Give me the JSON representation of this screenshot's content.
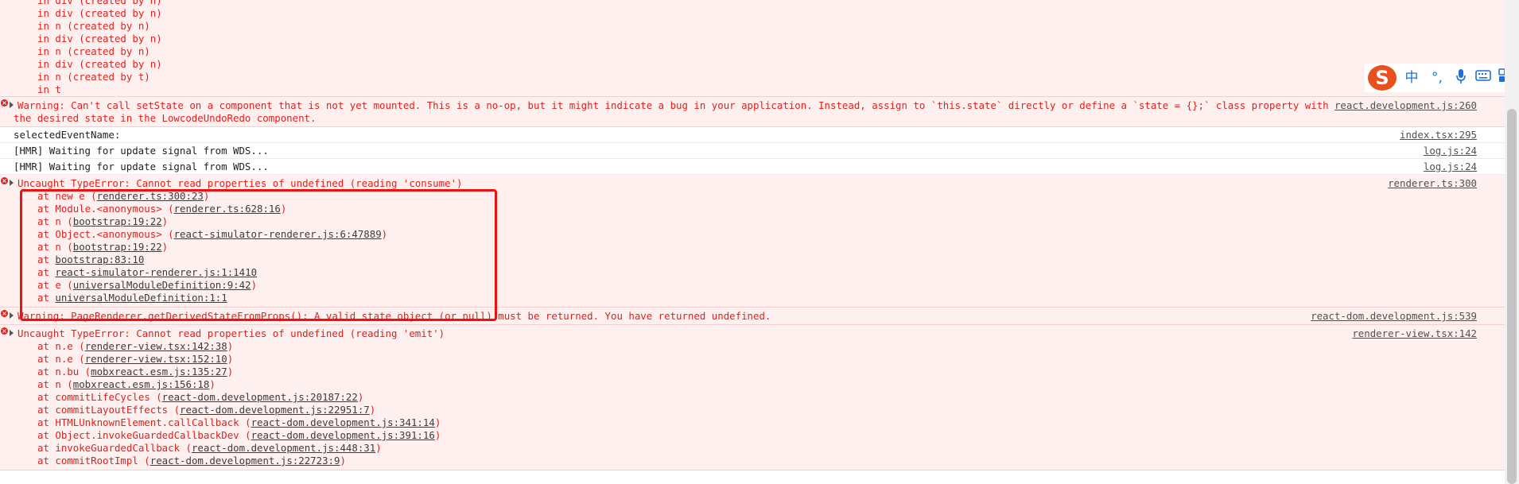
{
  "partial_top": [
    "in div (created by n)",
    "in div (created by n)",
    "in n (created by n)",
    "in div (created by n)",
    "in n (created by n)",
    "in div (created by n)",
    "in n (created by t)",
    "in t"
  ],
  "warning1": {
    "line1": "Warning: Can't call setState on a component that is not yet mounted. This is a no-op, but it might indicate a bug in your application. Instead, assign to `this.state` directly or define a `state = {};` class property with",
    "line2": "the desired state in the LowcodeUndoRedo component.",
    "source": "react.development.js:260"
  },
  "log1": {
    "text": "selectedEventName:",
    "source": "index.tsx:295"
  },
  "log2": {
    "text": "[HMR] Waiting for update signal from WDS...",
    "source": "log.js:24"
  },
  "log3": {
    "text": "[HMR] Waiting for update signal from WDS...",
    "source": "log.js:24"
  },
  "error1": {
    "message": "Uncaught TypeError: Cannot read properties of undefined (reading 'consume')",
    "source": "renderer.ts:300",
    "stack": [
      {
        "prefix": "at new e (",
        "link": "renderer.ts:300:23",
        "suffix": ")"
      },
      {
        "prefix": "at Module.<anonymous> (",
        "link": "renderer.ts:628:16",
        "suffix": ")"
      },
      {
        "prefix": "at n (",
        "link": "bootstrap:19:22",
        "suffix": ")"
      },
      {
        "prefix": "at Object.<anonymous> (",
        "link": "react-simulator-renderer.js:6:47889",
        "suffix": ")"
      },
      {
        "prefix": "at n (",
        "link": "bootstrap:19:22",
        "suffix": ")"
      },
      {
        "prefix": "at ",
        "link": "bootstrap:83:10",
        "suffix": ""
      },
      {
        "prefix": "at ",
        "link": "react-simulator-renderer.js:1:1410",
        "suffix": ""
      },
      {
        "prefix": "at e (",
        "link": "universalModuleDefinition:9:42",
        "suffix": ")"
      },
      {
        "prefix": "at ",
        "link": "universalModuleDefinition:1:1",
        "suffix": ""
      }
    ]
  },
  "warning2": {
    "message": "Warning: PageRenderer.getDerivedStateFromProps(): A valid state object (or null) must be returned. You have returned undefined.",
    "source": "react-dom.development.js:539"
  },
  "error2": {
    "message": "Uncaught TypeError: Cannot read properties of undefined (reading 'emit')",
    "source": "renderer-view.tsx:142",
    "stack": [
      {
        "prefix": "at n.e (",
        "link": "renderer-view.tsx:142:38",
        "suffix": ")"
      },
      {
        "prefix": "at n.e (",
        "link": "renderer-view.tsx:152:10",
        "suffix": ")"
      },
      {
        "prefix": "at n.bu (",
        "link": "mobxreact.esm.js:135:27",
        "suffix": ")"
      },
      {
        "prefix": "at n (",
        "link": "mobxreact.esm.js:156:18",
        "suffix": ")"
      },
      {
        "prefix": "at commitLifeCycles (",
        "link": "react-dom.development.js:20187:22",
        "suffix": ")"
      },
      {
        "prefix": "at commitLayoutEffects (",
        "link": "react-dom.development.js:22951:7",
        "suffix": ")"
      },
      {
        "prefix": "at HTMLUnknownElement.callCallback (",
        "link": "react-dom.development.js:341:14",
        "suffix": ")"
      },
      {
        "prefix": "at Object.invokeGuardedCallbackDev (",
        "link": "react-dom.development.js:391:16",
        "suffix": ")"
      },
      {
        "prefix": "at invokeGuardedCallback (",
        "link": "react-dom.development.js:448:31",
        "suffix": ")"
      },
      {
        "prefix": "at commitRootImpl (",
        "link": "react-dom.development.js:22723:9",
        "suffix": ")"
      }
    ]
  },
  "ime": {
    "logo": "S",
    "chinese": "中",
    "punct": "°,",
    "mic_icon": "mic-icon",
    "keyboard_icon": "keyboard-icon",
    "grid_icon": "grid-icon"
  },
  "colors": {
    "error_text": "#e0211c",
    "error_bg": "#fff0f0",
    "highlight_box": "#ee1111"
  }
}
